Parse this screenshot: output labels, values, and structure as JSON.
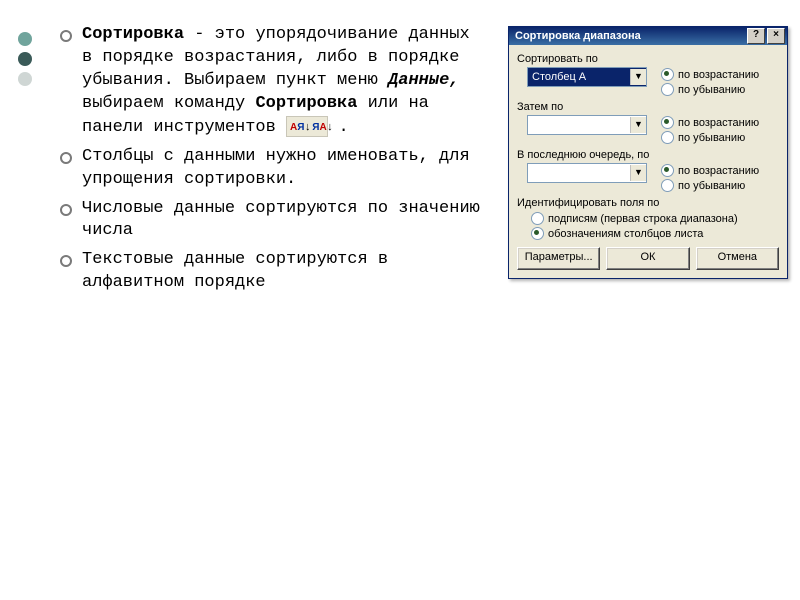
{
  "bullets": [
    {
      "lead": "Сортировка",
      "dash": " - ",
      "t1": "это упорядочивание данных в порядке возрастания, либо в порядке убывания. Выбираем пункт меню ",
      "menu": "Данные,",
      "t2": " выбираем команду ",
      "cmd": "Сортировка",
      "t3": " или на панели инструментов ",
      "tail": " ."
    },
    {
      "text": "Столбцы с данными нужно именовать, для упрощения сортировки."
    },
    {
      "text": "Числовые данные сортируются по значению числа"
    },
    {
      "text": "Текстовые данные сортируются в алфавитном порядке"
    }
  ],
  "sort_icon": {
    "a": "А",
    "ya": "Я",
    "down": "↓"
  },
  "dialog": {
    "title": "Сортировка диапазона",
    "help": "?",
    "close": "×",
    "group1": "Сортировать по",
    "combo1": "Столбец A",
    "group2": "Затем по",
    "group3": "В последнюю очередь, по",
    "asc": "по возрастанию",
    "desc": "по убыванию",
    "ident_label": "Идентифицировать поля по",
    "ident1": "подписям (первая строка диапазона)",
    "ident2": "обозначениям столбцов листа",
    "btn_params": "Параметры...",
    "btn_ok": "ОК",
    "btn_cancel": "Отмена"
  }
}
